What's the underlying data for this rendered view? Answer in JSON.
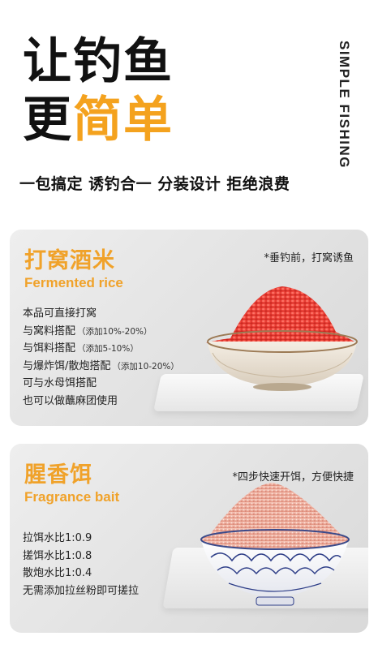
{
  "header": {
    "line1": "让钓鱼",
    "line2_black": "更",
    "line2_orange": "简单",
    "vertical_tag": "SIMPLE FISHING",
    "tagline": "一包搞定 诱钓合一 分装设计 拒绝浪费"
  },
  "colors": {
    "accent": "#f0a22a",
    "text": "#111111",
    "card_bg": "#e6e6e6",
    "rice_red": "#e8413b",
    "bait_pink": "#e8a899"
  },
  "cards": [
    {
      "title": "打窝酒米",
      "subtitle": "Fermented rice",
      "note": "*垂钓前，打窝诱鱼",
      "lines": [
        {
          "text": "本品可直接打窝",
          "small": ""
        },
        {
          "text": "与窝料搭配",
          "small": "（添加10%-20%）"
        },
        {
          "text": "与饵料搭配",
          "small": "（添加5-10%）"
        },
        {
          "text": "与爆炸饵/散炮搭配",
          "small": "（添加10-20%）"
        },
        {
          "text": "可与水母饵搭配",
          "small": ""
        },
        {
          "text": "也可以做蘸麻团使用",
          "small": ""
        }
      ]
    },
    {
      "title": "腥香饵",
      "subtitle": "Fragrance bait",
      "note": "*四步快速开饵，方便快捷",
      "lines": [
        {
          "text": "拉饵水比1:0.9",
          "small": ""
        },
        {
          "text": "搓饵水比1:0.8",
          "small": ""
        },
        {
          "text": "散炮水比1:0.4",
          "small": ""
        },
        {
          "text": "无需添加拉丝粉即可搓拉",
          "small": ""
        }
      ]
    }
  ]
}
